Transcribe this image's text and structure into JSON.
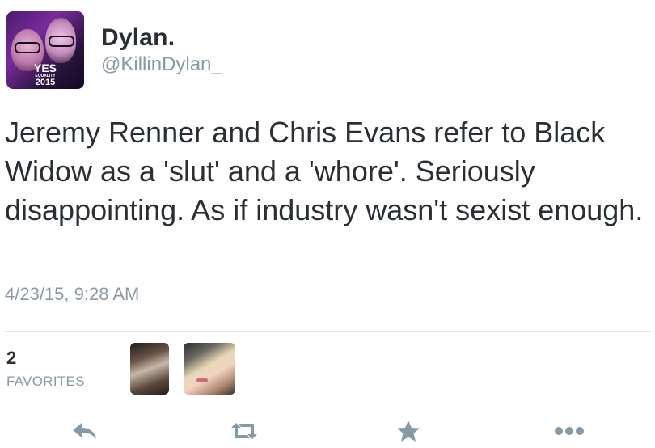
{
  "user": {
    "display_name": "Dylan.",
    "handle": "@KillinDylan_",
    "avatar_text": "YES",
    "avatar_subtext": "EQUALITY",
    "avatar_year": "2015"
  },
  "tweet": {
    "text": "Jeremy Renner and Chris Evans refer to Black Widow as a 'slut' and a 'whore'. Seriously disappointing. As if industry wasn't sexist enough.",
    "timestamp": "4/23/15, 9:28 AM"
  },
  "stats": {
    "favorites_count": "2",
    "favorites_label": "FAVORITES"
  },
  "actions": [
    {
      "name": "reply",
      "icon": "reply-icon"
    },
    {
      "name": "retweet",
      "icon": "retweet-icon"
    },
    {
      "name": "favorite",
      "icon": "star-icon"
    },
    {
      "name": "more",
      "icon": "more-icon"
    }
  ],
  "colors": {
    "text": "#292f33",
    "secondary": "#8899a6",
    "divider": "#e1e8ed",
    "icon": "#8899a6"
  }
}
